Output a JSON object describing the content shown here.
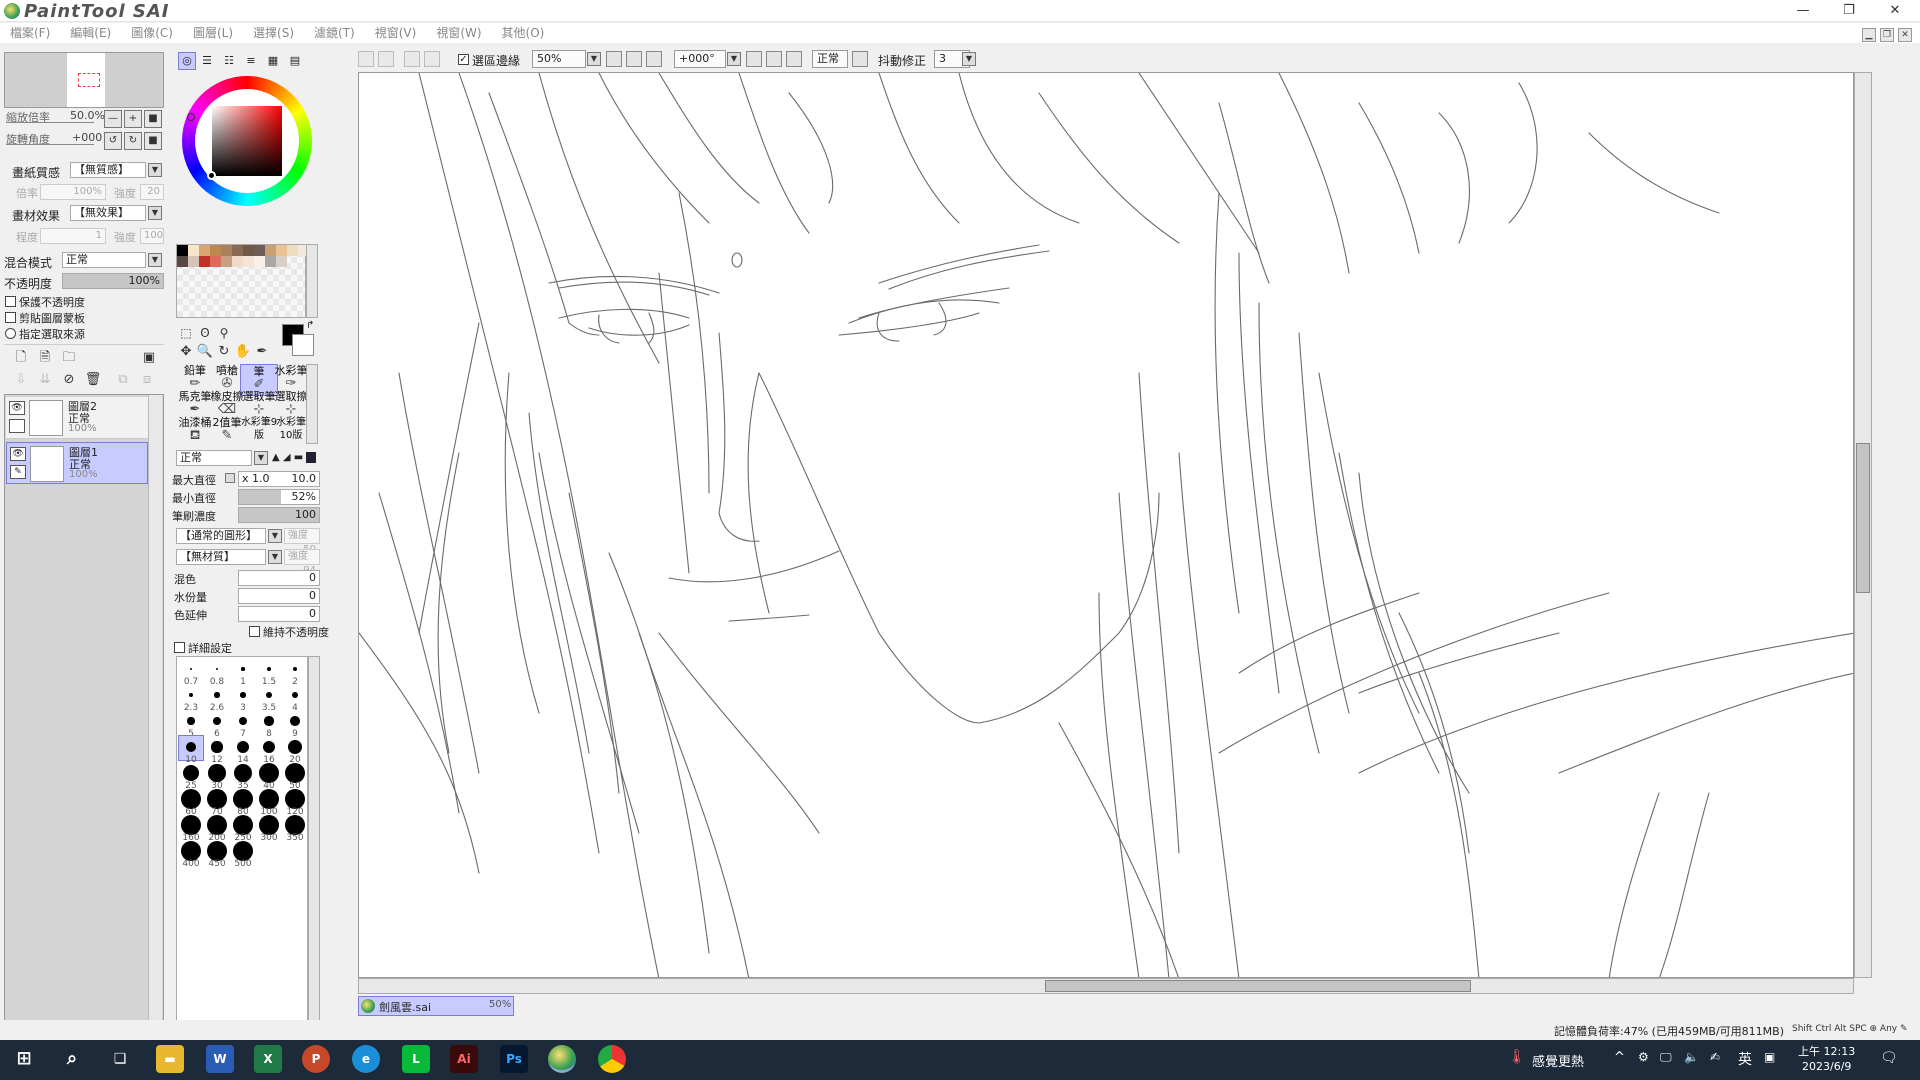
{
  "app": {
    "logo": "PaintTool SAI"
  },
  "window": {
    "minimize": "—",
    "restore": "❐",
    "close": "✕",
    "mdi_min": "▁",
    "mdi_restore": "❐",
    "mdi_close": "✕"
  },
  "menu": [
    "檔案(F)",
    "編輯(E)",
    "圖像(C)",
    "圖層(L)",
    "選擇(S)",
    "濾鏡(T)",
    "視窗(V)",
    "視窗(W)",
    "其他(O)"
  ],
  "navigator": {
    "zoom_label": "縮放倍率",
    "zoom_value": "50.0%",
    "rotate_label": "旋轉角度",
    "rotate_value": "+000"
  },
  "paper": {
    "texture_label": "畫紙質感",
    "texture_value": "【無質感】",
    "texture_scale_label": "倍率",
    "texture_scale": "100%",
    "texture_strength_label": "強度",
    "texture_strength": "20",
    "effect_label": "畫材效果",
    "effect_value": "【無效果】",
    "effect_degree_label": "程度",
    "effect_degree": "1",
    "effect_strength_label": "強度",
    "effect_strength": "100"
  },
  "layer_props": {
    "blend_label": "混合模式",
    "blend_value": "正常",
    "opacity_label": "不透明度",
    "opacity_value": "100%",
    "opacity_fraction": 1.0,
    "protect_opacity": "保護不透明度",
    "clip_group": "剪貼圖層蒙板",
    "selection_source": "指定選取來源"
  },
  "layers": [
    {
      "name": "圖層2",
      "mode": "正常",
      "opacity": "100%"
    },
    {
      "name": "圖層1",
      "mode": "正常",
      "opacity": "100%"
    }
  ],
  "tools": [
    [
      "鉛筆",
      "噴槍",
      "筆",
      "水彩筆"
    ],
    [
      "馬克筆",
      "橡皮擦",
      "選取筆",
      "選取擦"
    ],
    [
      "油漆桶",
      "2值筆",
      "水彩筆9版",
      "水彩筆10版"
    ]
  ],
  "brush": {
    "mode": "正常",
    "max_size_label": "最大直徑",
    "max_size_mult": "x 1.0",
    "max_size": "10.0",
    "min_size_label": "最小直徑",
    "min_size": "52%",
    "min_size_fraction": 0.52,
    "density_label": "筆刷濃度",
    "density": "100",
    "density_fraction": 1.0,
    "shape": "【通常的圓形】",
    "shape_strength_label": "強度",
    "shape_strength": "50",
    "texture": "【無材質】",
    "texture_strength_label": "強度",
    "texture_strength": "94",
    "blend_label": "混色",
    "blend": "0",
    "water_label": "水份量",
    "water": "0",
    "persistence_label": "色延伸",
    "persistence": "0",
    "keep_opacity": "維持不透明度",
    "advanced": "詳細設定"
  },
  "brush_sizes": [
    "0.7",
    "0.8",
    "1",
    "1.5",
    "2",
    "2.3",
    "2.6",
    "3",
    "3.5",
    "4",
    "5",
    "6",
    "7",
    "8",
    "9",
    "10",
    "12",
    "14",
    "16",
    "20",
    "25",
    "30",
    "35",
    "40",
    "50",
    "60",
    "70",
    "80",
    "100",
    "120",
    "160",
    "200",
    "250",
    "300",
    "350",
    "400",
    "450",
    "500"
  ],
  "canvas_toolbar": {
    "selection_edge": "選區邊緣",
    "zoom": "50%",
    "rotate": "+000°",
    "mode": "正常",
    "stabilizer_label": "抖動修正",
    "stabilizer": "3"
  },
  "document_tab": {
    "name": "劍風雲.sai",
    "zoom": "50%"
  },
  "status": {
    "memory": "記憶體負荷率:47% (已用459MB/可用811MB)",
    "keys": "Shift Ctrl Alt SPC ⊕ Any ✎"
  },
  "taskbar": {
    "weather": "感覺更熱",
    "ime": "英",
    "time": "上午 12:13",
    "date": "2023/6/9"
  },
  "colors": {
    "accent_select": "#c8cbff",
    "swatches": [
      "#000000",
      "#f7e6c8",
      "#d9a570",
      "#bf8750",
      "#a97f5e",
      "#8a6a52",
      "#6f5a4a",
      "#705d58",
      "#c9a06e",
      "#e8c394",
      "#f0dcc0",
      "#f2e8dc",
      "#5a4844",
      "#d7c4b8",
      "#c2302a",
      "#e06a5a",
      "#c79f83",
      "#efdcc8",
      "#f3e6d6",
      "#fbf0e8",
      "#a8a8a8",
      "#d8d0c8"
    ]
  }
}
